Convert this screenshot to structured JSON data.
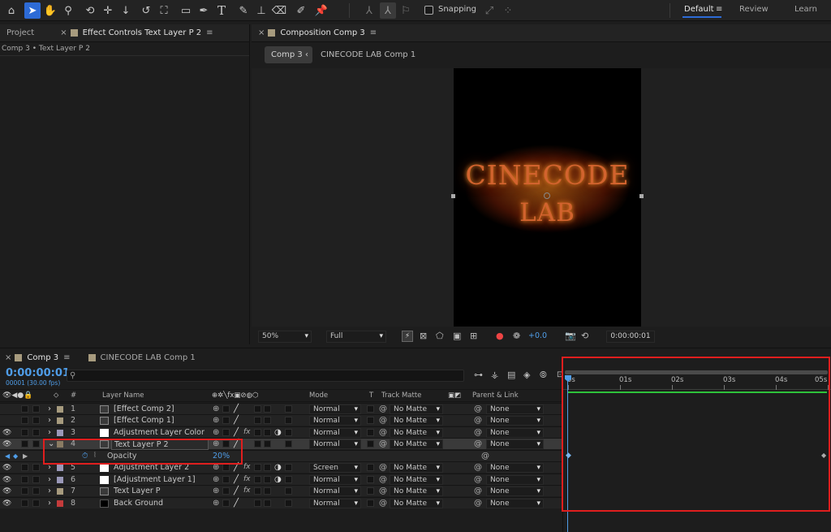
{
  "toolbar": {
    "snapping_label": "Snapping",
    "workspaces": [
      "Default",
      "Review",
      "Learn"
    ],
    "menu_glyph": "≡"
  },
  "effect_controls": {
    "project_tab": "Project",
    "tab_title": "Effect Controls Text Layer P 2",
    "breadcrumb": "Comp 3 • Text Layer P 2"
  },
  "composition": {
    "tab_title": "Composition Comp 3",
    "nav_active": "Comp 3",
    "nav_other": "CINECODE LAB Comp 1",
    "canvas_text_line1": "CINECODE",
    "canvas_text_line2": "LAB",
    "zoom": "50%",
    "resolution": "Full",
    "exposure": "+0.0",
    "timecode": "0:00:00:01"
  },
  "timeline": {
    "tab_active": "Comp 3",
    "tab_other": "CINECODE LAB Comp 1",
    "current_time": "0:00:00:01",
    "frame_info": "00001 (30.00 fps)",
    "search_placeholder": "",
    "headers": {
      "hash": "#",
      "layer_name": "Layer Name",
      "mode": "Mode",
      "t": "T",
      "track_matte": "Track Matte",
      "parent_link": "Parent & Link"
    },
    "ruler": [
      "0s",
      "01s",
      "02s",
      "03s",
      "04s",
      "05s"
    ],
    "layers": [
      {
        "num": "1",
        "name": "[Effect Comp 2]",
        "mode": "Normal",
        "matte": "No Matte",
        "parent": "None",
        "label_color": "#a79b7e",
        "bar_color": "#6b6150"
      },
      {
        "num": "2",
        "name": "[Effect Comp 1]",
        "mode": "Normal",
        "matte": "No Matte",
        "parent": "None",
        "label_color": "#a79b7e",
        "bar_color": "#6b6150"
      },
      {
        "num": "3",
        "name": "Adjustment Layer Color",
        "mode": "Normal",
        "matte": "No Matte",
        "parent": "None",
        "label_color": "#9a98b8",
        "bar_color": "#5c5b70"
      },
      {
        "num": "4",
        "name": "Text Layer P 2",
        "mode": "Normal",
        "matte": "No Matte",
        "parent": "None",
        "label_color": "#8a7b63",
        "bar_color": "#7d6e57"
      },
      {
        "num": "5",
        "name": "Adjustment Layer 2",
        "mode": "Screen",
        "matte": "No Matte",
        "parent": "None",
        "label_color": "#9a98b8",
        "bar_color": "#5c5b70"
      },
      {
        "num": "6",
        "name": "[Adjustment Layer 1]",
        "mode": "Normal",
        "matte": "No Matte",
        "parent": "None",
        "label_color": "#9a98b8",
        "bar_color": "#5c5b70"
      },
      {
        "num": "7",
        "name": "Text Layer P",
        "mode": "Normal",
        "matte": "No Matte",
        "parent": "None",
        "label_color": "#a79b7e",
        "bar_color": "#6b6150"
      },
      {
        "num": "8",
        "name": "Back Ground",
        "mode": "Normal",
        "matte": "No Matte",
        "parent": "None",
        "label_color": "#c43b3b",
        "bar_color": "#7a3434"
      }
    ],
    "property": {
      "name": "Opacity",
      "value": "20",
      "unit": "%"
    }
  },
  "colors": {
    "accent": "#2d6bd6",
    "highlight_red": "#e01e1e",
    "timecode_blue": "#4f9de8"
  }
}
